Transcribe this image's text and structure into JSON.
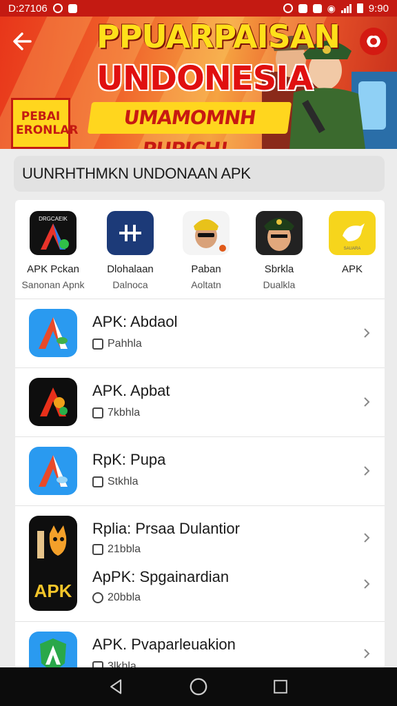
{
  "status_bar": {
    "time": "D:27106",
    "clock": "9:90"
  },
  "banner": {
    "title_line1": "PPUARPAISAN",
    "title_line2": "UNDONESIA",
    "title_line3": "UMAMOMNH PUPICH!",
    "badge": "PEBAI ERONLAR",
    "accent": "#c41a12"
  },
  "search": {
    "value": "UUNRHTHMKN UNDONAAN APK"
  },
  "top_apps": [
    {
      "name": "APK Pckan",
      "sub": "Sanonan Apnk",
      "icon": "colorful-a-icon",
      "icon_label": "DRGCAEIK"
    },
    {
      "name": "Dlohalaan",
      "sub": "Dalnoca",
      "icon": "plus-tile-icon"
    },
    {
      "name": "Paban",
      "sub": "Aoltatn",
      "icon": "soldier-portrait-icon"
    },
    {
      "name": "Sbrkla",
      "sub": "Dualkla",
      "icon": "officer-portrait-icon"
    },
    {
      "name": "APK",
      "sub": "",
      "icon": "yellow-bird-icon",
      "icon_label": "SAUARA"
    }
  ],
  "list": [
    {
      "name": "APK: Abdaol",
      "sub": "Pahhla",
      "icon": "blue-a-icon"
    },
    {
      "name": "APK. Apbat",
      "sub": "7kbhla",
      "icon": "red-a-icon"
    },
    {
      "name": "RpK: Pupa",
      "sub": "Stkhla",
      "icon": "blue-a-icon"
    },
    {
      "name": "Rplia: Prsaa Dulantior",
      "sub": "21bbla",
      "name2": "ApPK: Spgainardian",
      "sub2": "20bbla",
      "icon": "apk-cat-icon",
      "icon_label": "APK"
    },
    {
      "name": "APK. Pvaparleuakion",
      "sub": "3lkhla",
      "icon": "green-a-shield-icon"
    }
  ]
}
